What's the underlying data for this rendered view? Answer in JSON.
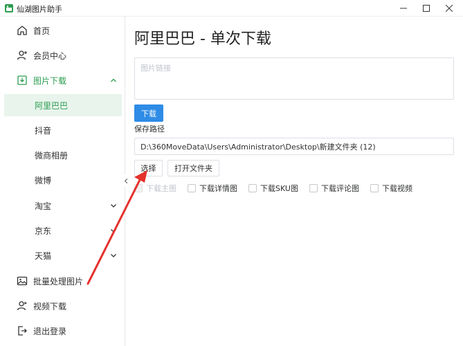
{
  "window": {
    "title": "仙湖图片助手",
    "icon": "app-logo-icon"
  },
  "sidebar": {
    "items": [
      {
        "label": "首页",
        "icon": "home-icon"
      },
      {
        "label": "会员中心",
        "icon": "user-icon"
      },
      {
        "label": "图片下载",
        "icon": "download-icon",
        "expanded": true
      },
      {
        "label": "阿里巴巴",
        "selected": true
      },
      {
        "label": "抖音"
      },
      {
        "label": "微商相册"
      },
      {
        "label": "微博"
      },
      {
        "label": "淘宝",
        "has_children": true
      },
      {
        "label": "京东",
        "has_children": true
      },
      {
        "label": "天猫",
        "has_children": true
      },
      {
        "label": "批量处理图片",
        "icon": "image-icon"
      },
      {
        "label": "视频下载",
        "icon": "video-user-icon"
      },
      {
        "label": "退出登录",
        "icon": "logout-icon"
      }
    ]
  },
  "main": {
    "title": "阿里巴巴 - 单次下载",
    "link_placeholder": "图片链接",
    "download_button": "下载",
    "save_path_label": "保存路径",
    "save_path_value": "D:\\360MoveData\\Users\\Administrator\\Desktop\\新建文件夹 (12)",
    "choose_button": "选择",
    "open_folder_button": "打开文件夹",
    "options": [
      {
        "label": "下载主图",
        "disabled": true
      },
      {
        "label": "下载详情图"
      },
      {
        "label": "下载SKU图"
      },
      {
        "label": "下载评论图"
      },
      {
        "label": "下载视频"
      }
    ]
  },
  "colors": {
    "accent_green": "#2c9d4f",
    "primary_blue": "#2e8ce6",
    "annotation_red": "#e5312b"
  }
}
